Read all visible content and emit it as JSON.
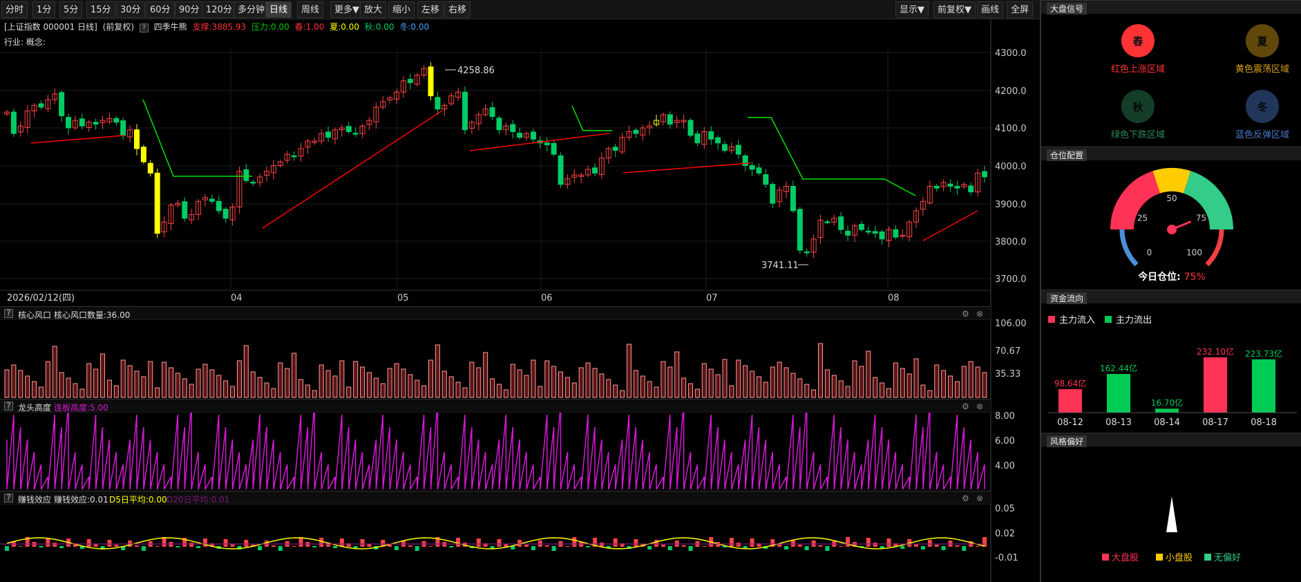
{
  "toolbar": {
    "periods": [
      "分时",
      "1分",
      "5分",
      "15分",
      "30分",
      "60分",
      "90分",
      "120分",
      "多分钟",
      "日线",
      "周线",
      "更多▼",
      "放大",
      "缩小",
      "左移",
      "右移"
    ],
    "right": [
      "显示▼",
      "前复权▼",
      "画线",
      "全屏"
    ],
    "active": "日线"
  },
  "info": {
    "title": "[上证指数 000001 日线]",
    "adjust": "(前复权)",
    "q": "?",
    "ind_name": "四季牛熊",
    "support": "支撑:3885.93",
    "pressure": "压力:0.00",
    "spring": "春:1.00",
    "summer": "夏:0.00",
    "autumn": "秋:0.00",
    "winter": "冬:0.00"
  },
  "industry": "行业: 概念:",
  "main": {
    "y_ticks": [
      "4300.0",
      "4200.0",
      "4100.0",
      "4000.0",
      "3900.0",
      "3800.0",
      "3700.0"
    ],
    "high_label": "4258.86",
    "low_label": "3741.11",
    "date_label": "2026/02/12(四)",
    "months": [
      "04",
      "05",
      "06",
      "07",
      "08"
    ]
  },
  "panels": [
    {
      "q": "?",
      "name": "核心风口",
      "value": "核心风口数量:36.00",
      "ticks": [
        "106.00",
        "70.67",
        "35.33"
      ]
    },
    {
      "q": "?",
      "name": "龙头高度",
      "value": "连板高度:5.00",
      "ticks": [
        "8.00",
        "6.00",
        "4.00"
      ]
    },
    {
      "q": "?",
      "name": "赚钱效应",
      "value": "赚钱效应:0.01",
      "d5": "D5日平均:0.00",
      "d20": "D20日平均:0.01",
      "ticks": [
        "0.05",
        "0.02",
        "-0.01"
      ]
    }
  ],
  "right": {
    "s1": "大盘信号",
    "signals": [
      {
        "char": "春",
        "label": "红色上涨区域",
        "color": "#ff3333"
      },
      {
        "char": "夏",
        "label": "黄色震荡区域",
        "color": "#d4a017"
      },
      {
        "char": "秋",
        "label": "绿色下跌区域",
        "color": "#2e8b57"
      },
      {
        "char": "冬",
        "label": "蓝色反弹区域",
        "color": "#4a78c8"
      }
    ],
    "s2": "仓位配置",
    "gauge": {
      "ticks": [
        "0",
        "25",
        "50",
        "75",
        "100"
      ],
      "label": "今日仓位:",
      "value": "75%"
    },
    "s3": "资金流向",
    "flow_legend": [
      "主力流入",
      "主力流出"
    ],
    "flow": [
      {
        "date": "08-12",
        "value": "98.64亿",
        "dir": "in",
        "amt": 98.64
      },
      {
        "date": "08-13",
        "value": "162.44亿",
        "dir": "out",
        "amt": 162.44
      },
      {
        "date": "08-14",
        "value": "16.70亿",
        "dir": "out",
        "amt": 16.7
      },
      {
        "date": "08-17",
        "value": "232.10亿",
        "dir": "in",
        "amt": 232.1
      },
      {
        "date": "08-18",
        "value": "223.73亿",
        "dir": "out",
        "amt": 223.73
      }
    ],
    "s4": "风格偏好",
    "style_legend": [
      "大盘股",
      "小盘股",
      "无偏好"
    ]
  },
  "colors": {
    "up": "#ff4444",
    "down": "#00cc66",
    "yellow": "#ffff00",
    "green_line": "#00e600",
    "red_line": "#ff0000",
    "magenta": "#d41ad4"
  }
}
